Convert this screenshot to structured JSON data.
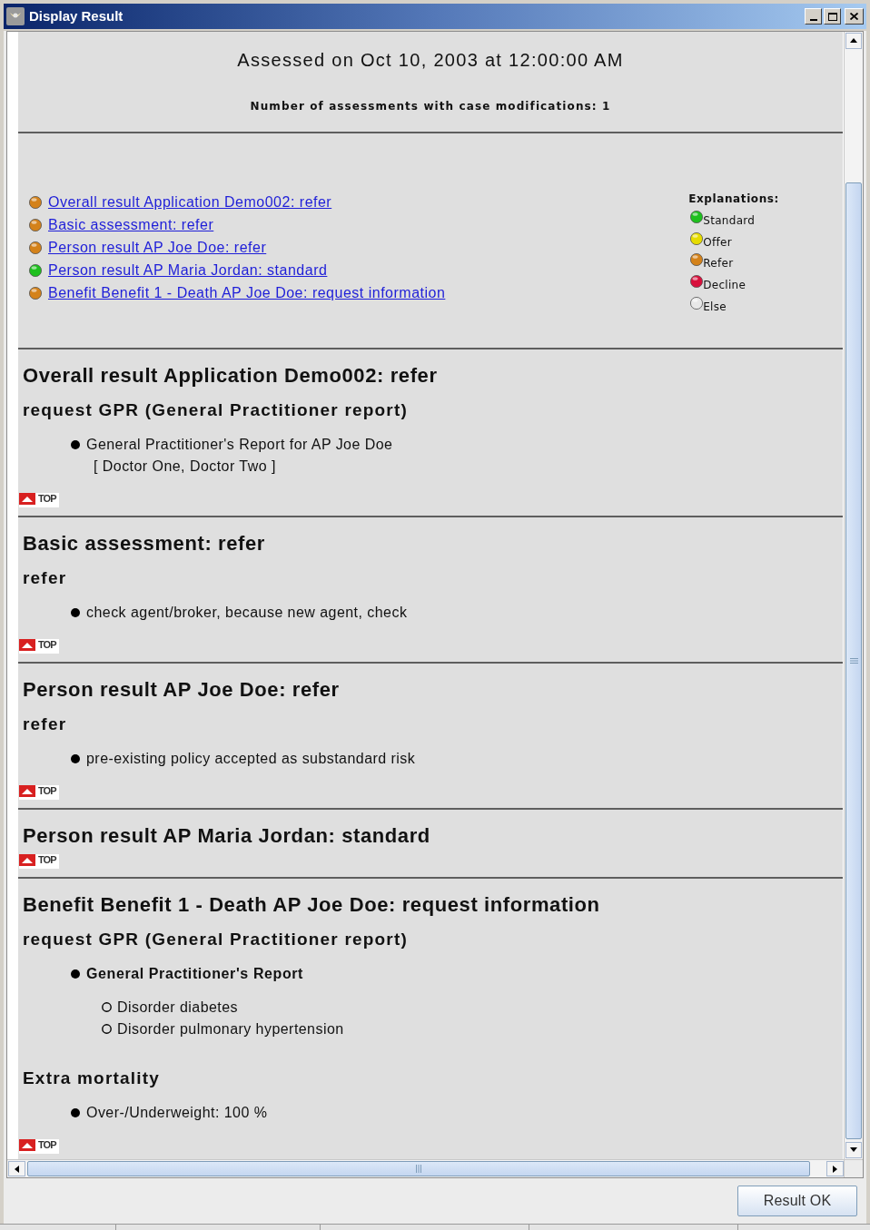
{
  "window": {
    "title": "Display Result"
  },
  "header": {
    "assessed": "Assessed on Oct 10, 2003 at 12:00:00 AM",
    "modifications": "Number of assessments with case modifications: 1"
  },
  "summary": {
    "links": [
      {
        "label": "Overall result Application Demo002: refer",
        "color": "#d4821a"
      },
      {
        "label": "Basic assessment: refer",
        "color": "#d4821a"
      },
      {
        "label": "Person result AP Joe Doe: refer",
        "color": "#d4821a"
      },
      {
        "label": "Person result AP Maria Jordan: standard",
        "color": "#1ec01e"
      },
      {
        "label": "Benefit Benefit 1 - Death AP Joe Doe: request information",
        "color": "#d4821a"
      }
    ]
  },
  "legend": {
    "title": "Explanations:",
    "items": [
      {
        "label": "Standard",
        "color": "#1ec01e"
      },
      {
        "label": "Offer",
        "color": "#e6dc00"
      },
      {
        "label": "Refer",
        "color": "#d4821a"
      },
      {
        "label": "Decline",
        "color": "#d8103c"
      },
      {
        "label": "Else",
        "color": "#e8e8e8"
      }
    ]
  },
  "sections": [
    {
      "title": "Overall result Application Demo002: refer",
      "blocks": [
        {
          "kind": "subheading",
          "text": "request GPR (General Practitioner report)"
        },
        {
          "kind": "bullet",
          "text": "General Practitioner's Report for AP Joe Doe",
          "detail": "[ Doctor One, Doctor Two ]"
        }
      ],
      "top_link": "TOP"
    },
    {
      "title": "Basic assessment: refer",
      "blocks": [
        {
          "kind": "subheading",
          "text": "refer"
        },
        {
          "kind": "bullet",
          "text": "check agent/broker, because new agent, check"
        }
      ],
      "top_link": "TOP"
    },
    {
      "title": "Person result AP Joe Doe: refer",
      "blocks": [
        {
          "kind": "subheading",
          "text": "refer"
        },
        {
          "kind": "bullet",
          "text": "pre-existing policy accepted as substandard risk"
        }
      ],
      "top_link": "TOP"
    },
    {
      "title": "Person result AP Maria Jordan: standard",
      "top_link": "TOP"
    },
    {
      "title": "Benefit Benefit 1 - Death AP Joe Doe: request information",
      "blocks": [
        {
          "kind": "subheading",
          "text": "request GPR (General Practitioner report)"
        },
        {
          "kind": "strong_bullet",
          "text": "General Practitioner's Report",
          "children": [
            {
              "text": "Disorder diabetes"
            },
            {
              "text": "Disorder pulmonary hypertension"
            }
          ]
        },
        {
          "kind": "subheading",
          "text": "Extra mortality"
        },
        {
          "kind": "bullet",
          "text": "Over-/Underweight: 100 %"
        }
      ],
      "top_link": "TOP"
    }
  ],
  "footer": {
    "button": "Result OK"
  }
}
